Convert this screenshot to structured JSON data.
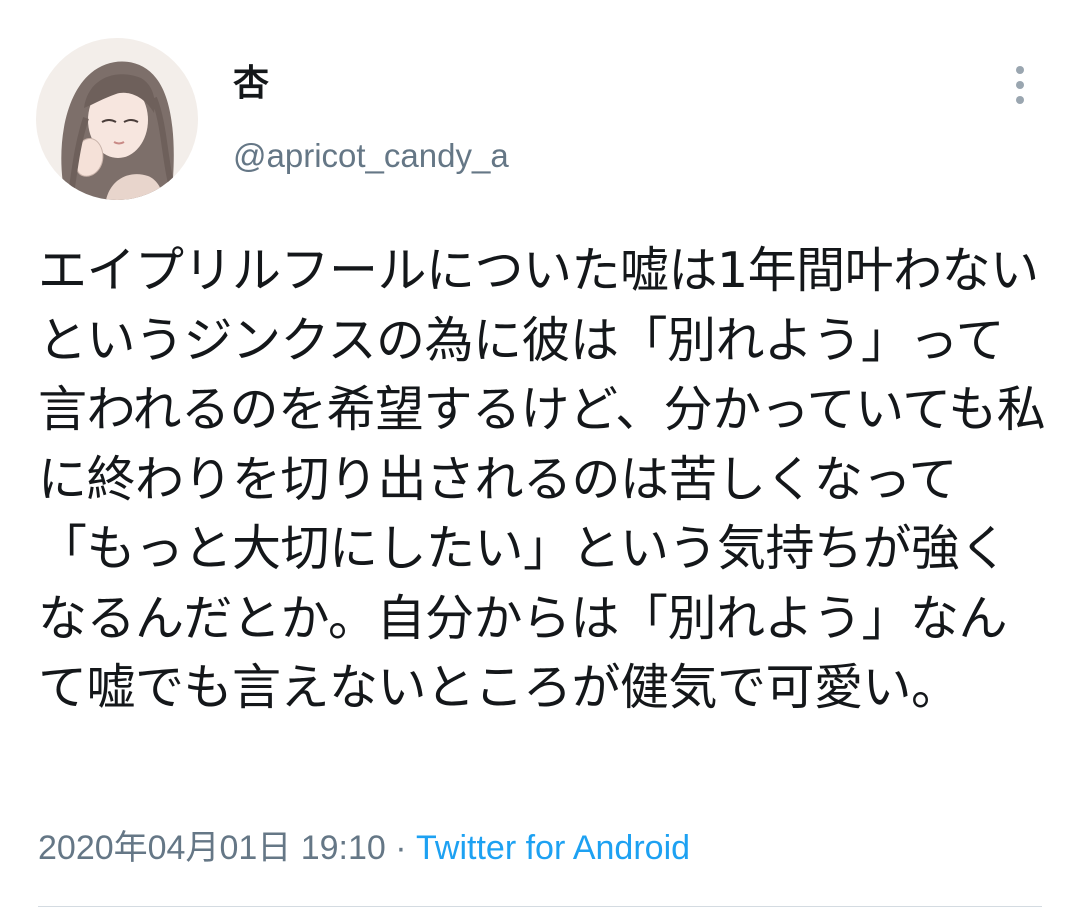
{
  "user": {
    "display_name": "杏",
    "handle": "@apricot_candy_a",
    "avatar_icon": "avatar-illustration"
  },
  "tweet": {
    "text": "エイプリルフールについた嘘は1年間叶わないというジンクスの為に彼は「別れよう」って言われるのを希望するけど、分かっていても私に終わりを切り出されるのは苦しくなって「もっと大切にしたい」という気持ちが強くなるんだとか。自分からは「別れよう」なんて嘘でも言えないところが健気で可愛い。",
    "timestamp": "2020年04月01日 19:10",
    "separator": " · ",
    "source": "Twitter for Android"
  },
  "menu": {
    "icon": "more-vertical-icon"
  },
  "colors": {
    "text": "#14171a",
    "secondary": "#657786",
    "link": "#1da1f2",
    "divider": "#d4dbe1"
  }
}
